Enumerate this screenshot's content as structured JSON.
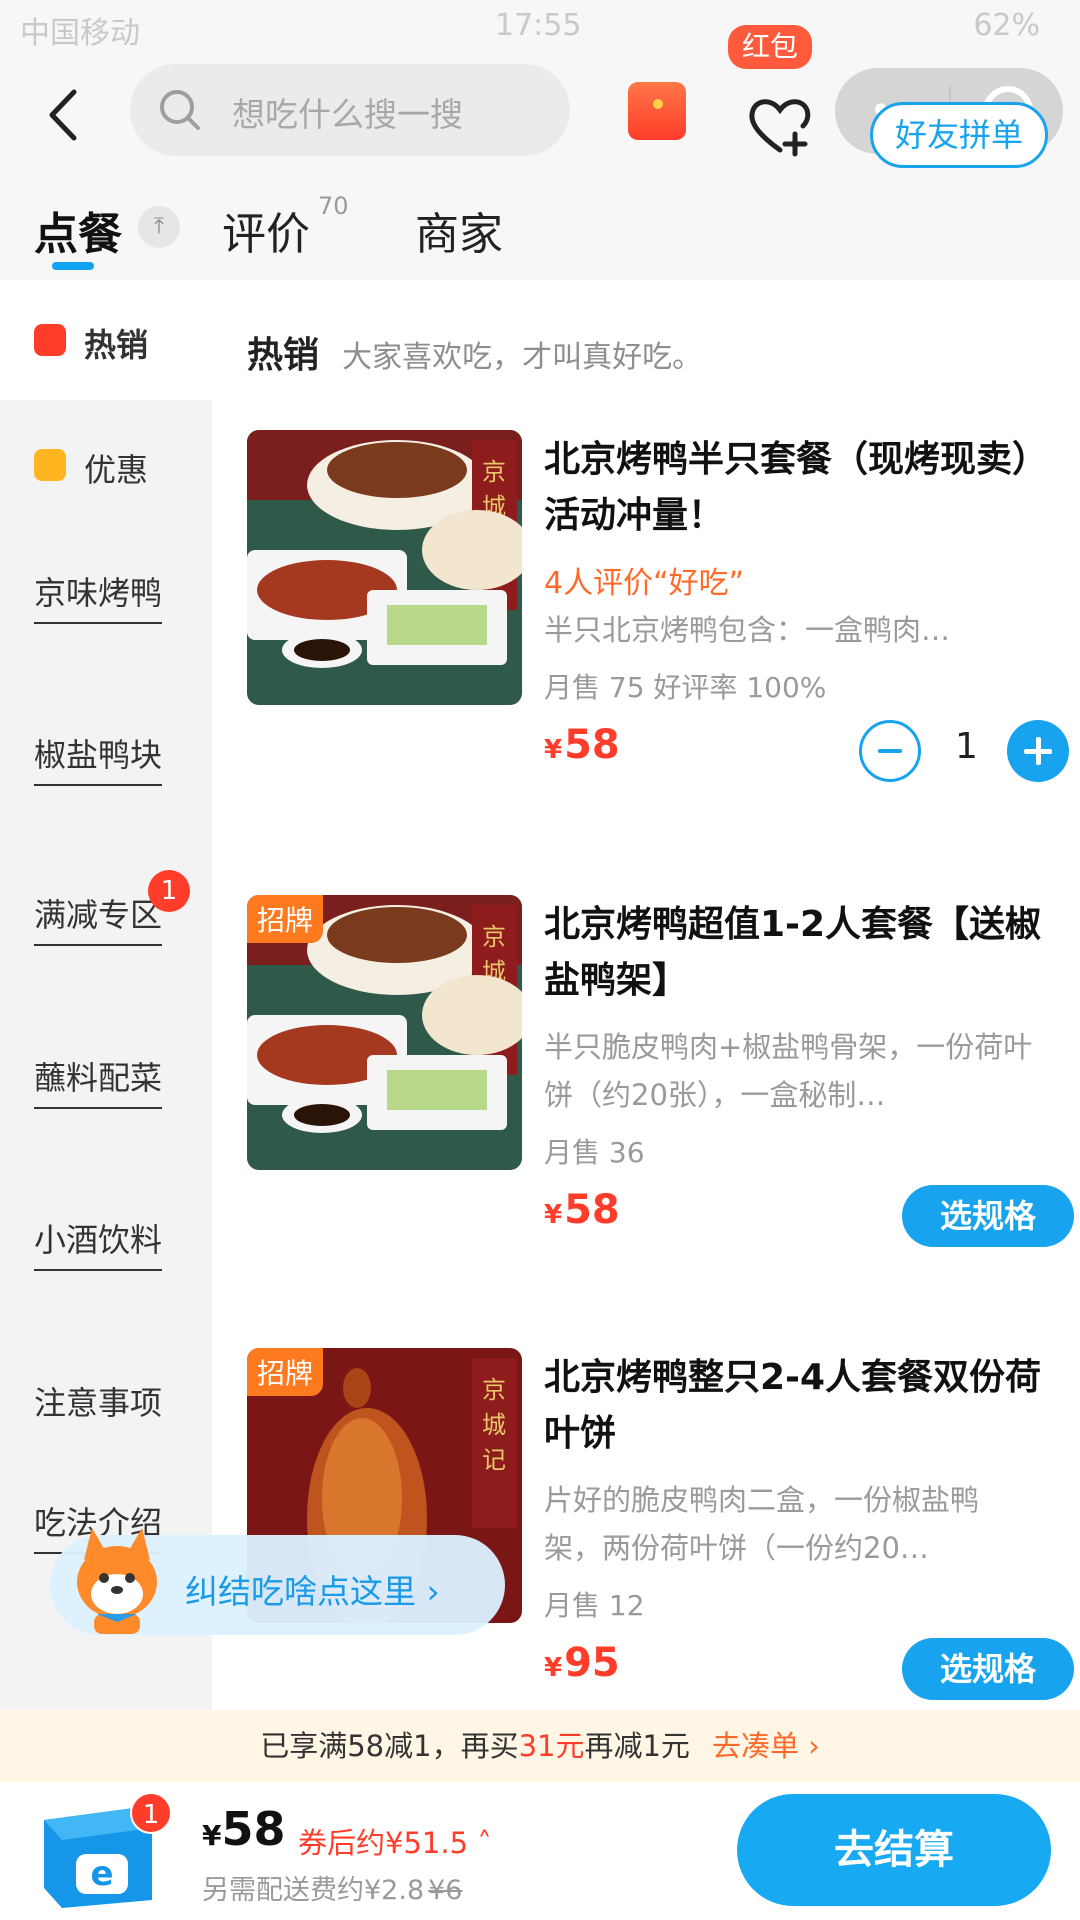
{
  "status_bar": {
    "carrier": "中国移动",
    "time": "17:55",
    "battery": "62%"
  },
  "header": {
    "search_placeholder": "想吃什么搜一搜",
    "fav_badge": "红包"
  },
  "tabs": [
    {
      "label": "点餐"
    },
    {
      "label": "评价",
      "count": "70"
    },
    {
      "label": "商家"
    }
  ],
  "friend_order_label": "好友拼单",
  "sidebar": {
    "items": [
      {
        "label": "热销"
      },
      {
        "label": "优惠"
      },
      {
        "label": "京味烤鸭"
      },
      {
        "label": "椒盐鸭块"
      },
      {
        "label": "满减专区",
        "badge": "1"
      },
      {
        "label": "蘸料配菜"
      },
      {
        "label": "小酒饮料"
      },
      {
        "label": "注意事项"
      },
      {
        "label": "吃法介绍"
      }
    ]
  },
  "section": {
    "title": "热销",
    "subtitle": "大家喜欢吃，才叫真好吃。"
  },
  "foods": [
    {
      "title": "北京烤鸭半只套餐（现烤现卖）活动冲量！",
      "review": "4人评价“好吃”",
      "desc": "半只北京烤鸭包含：一盒鸭肉…",
      "sales": "月售 75 好评率 100%",
      "yen": "¥",
      "price": "58",
      "qty": "1",
      "img_label": "京城记"
    },
    {
      "tag": "招牌",
      "title": "北京烤鸭超值1-2人套餐【送椒盐鸭架】",
      "desc": "半只脆皮鸭肉+椒盐鸭骨架，一份荷叶饼（约20张），一盒秘制…",
      "sales": "月售 36",
      "yen": "¥",
      "price": "58",
      "button": "选规格",
      "img_label": "京城记"
    },
    {
      "tag": "招牌",
      "title": "北京烤鸭整只2-4人套餐双份荷叶饼",
      "desc": "片好的脆皮鸭肉二盒，一份椒盐鸭架，两份荷叶饼（一份约20…",
      "sales": "月售 12",
      "yen": "¥",
      "price": "95",
      "button": "选规格",
      "img_label": "京城记"
    }
  ],
  "mascot_bubble": "纠结吃啥点这里",
  "promo": {
    "pre": "已享满58减1，再买",
    "amount": "31元",
    "post": "再减1元",
    "action": "去凑单"
  },
  "cart": {
    "badge": "1",
    "yen": "¥",
    "total": "58",
    "after_coupon": "券后约¥51.5",
    "delivery_prefix": "另需配送费约¥2.8",
    "delivery_original": "¥6",
    "checkout": "去结算"
  },
  "colors": {
    "accent": "#17a3ee",
    "price": "#ff3d2a",
    "review": "#ff6a2a",
    "tag": "#ff7a1f"
  }
}
